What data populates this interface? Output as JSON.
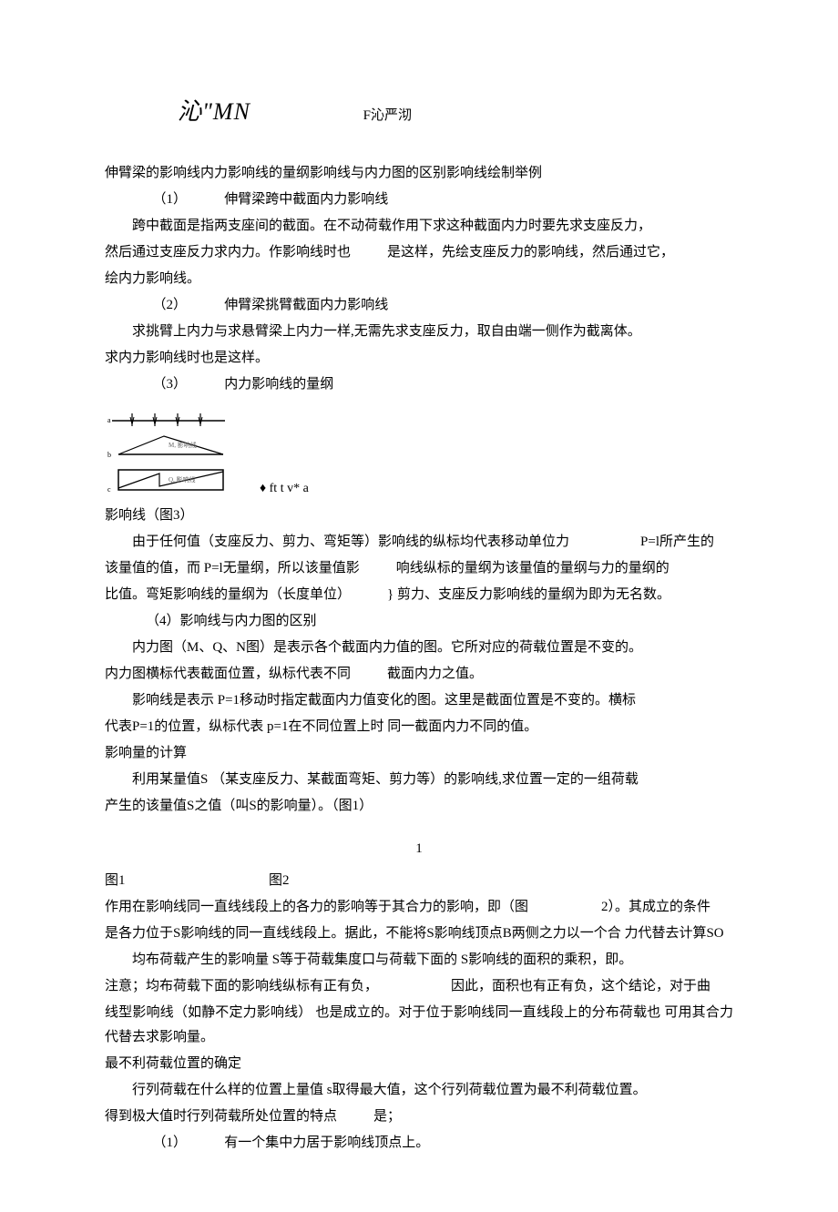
{
  "formula": {
    "left": "沁\"MN",
    "right": "F沁严沏"
  },
  "title1": "伸臂梁的影响线内力影响线的量纲影响线与内力图的区别影响线绘制举例",
  "item1": {
    "num": "（1）",
    "label": "伸臂梁跨中截面内力影响线"
  },
  "p1": "跨中截面是指两支座间的截面。在不动荷载作用下求这种截面内力时要先求支座反力，",
  "p2a": "然后通过支座反力求内力。作影响线时也",
  "p2b": "是这样，先绘支座反力的影响线，然后通过它，",
  "p3": "绘内力影响线。",
  "item2": {
    "num": "（2）",
    "label": "伸臂梁挑臂截面内力影响线"
  },
  "p4": "求挑臂上内力与求悬臂梁上内力一样,无需先求支座反力，取自由端一侧作为截离体。",
  "p5": "求内力影响线时也是这样。",
  "item3": {
    "num": "（3）",
    "label": "内力影响线的量纲"
  },
  "fig_right": "♦ ft t v* a",
  "fig3_caption": "影响线（图3）",
  "p6a": "由于任何值（支座反力、剪力、弯矩等）影响线的纵标均代表移动单位力",
  "p6b": "P=l所产生的",
  "p7a": "该量值的值，而 P=l无量纲，所以该量值影",
  "p7b": "响线纵标的量纲为该量值的量纲与力的量纲的",
  "p8a": "比值。弯矩影响线的量纲为（长度单位）",
  "p8b": "} 剪力、支座反力影响线的量纲为即为无名数。",
  "item4": "（4）影响线与内力图的区别",
  "p9": "内力图（M、Q、N图）是表示各个截面内力值的图。它所对应的荷载位置是不变的。",
  "p10a": "内力图横标代表截面位置，纵标代表不同",
  "p10b": "截面内力之值。",
  "p11": "影响线是表示 P=1移动时指定截面内力值变化的图。这里是截面位置是不变的。横标",
  "p12": "代表P=1的位置，纵标代表 p=1在不同位置上时 同一截面内力不同的值。",
  "title2": "影响量的计算",
  "p13": "利用某量值S （某支座反力、某截面弯矩、剪力等）的影响线,求位置一定的一组荷载",
  "p14": "产生的该量值S之值（叫S的影响量）。（图1）",
  "center1": "1",
  "fig1_label": "图1",
  "fig2_label": "图2",
  "p15a": "作用在影响线同一直线线段上的各力的影响等于其合力的影响，即（图",
  "p15b": "2）。其成立的条件",
  "p16": "是各力位于S影响线的同一直线线段上。据此，不能将S影响线顶点B两侧之力以一个合 力代替去计算SO",
  "p17": "均布荷载产生的影响量 S等于荷载集度口与荷载下面的 S影响线的面积的乘积，即。",
  "p18a": "注意；均布荷载下面的影响线纵标有正有负，",
  "p18b": "因此，面积也有正有负，这个结论，对于曲",
  "p19": "线型影响线（如静不定力影响线） 也是成立的。对于位于影响线同一直线段上的分布荷载也 可用其合力代替去求影响量。",
  "title3": "最不利荷载位置的确定",
  "p20": "行列荷载在什么样的位置上量值 s取得最大值，这个行列荷载位置为最不利荷载位置。",
  "p21a": "得到极大值时行列荷载所处位置的特点",
  "p21b": "是；",
  "item5": {
    "num": "（1）",
    "label": "有一个集中力居于影响线顶点上。"
  }
}
